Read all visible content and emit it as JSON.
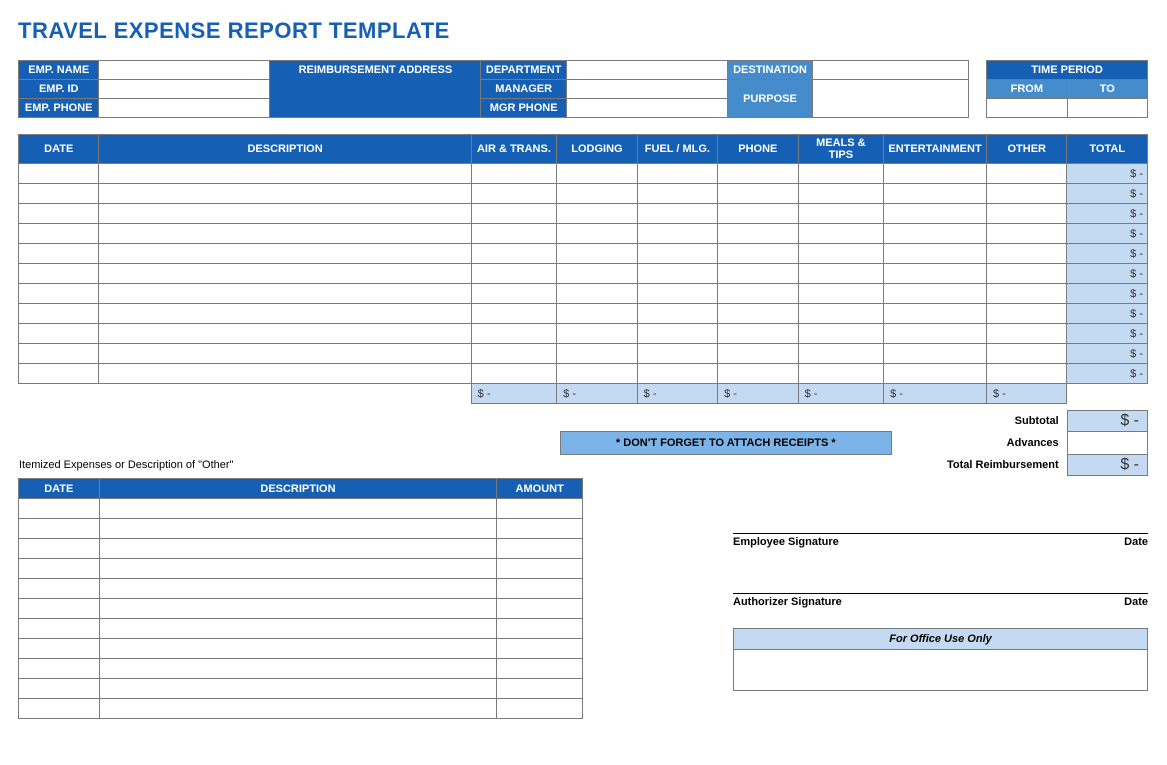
{
  "title": "TRAVEL EXPENSE REPORT TEMPLATE",
  "header": {
    "emp_name": "EMP. NAME",
    "emp_id": "EMP. ID",
    "emp_phone": "EMP. PHONE",
    "reimb_addr": "REIMBURSEMENT ADDRESS",
    "department": "DEPARTMENT",
    "manager": "MANAGER",
    "mgr_phone": "MGR PHONE",
    "destination": "DESTINATION",
    "purpose": "PURPOSE",
    "time_period": "TIME PERIOD",
    "from": "FROM",
    "to": "TO"
  },
  "cols": {
    "date": "DATE",
    "description": "DESCRIPTION",
    "air": "AIR & TRANS.",
    "lodging": "LODGING",
    "fuel": "FUEL / MLG.",
    "phone": "PHONE",
    "meals": "MEALS & TIPS",
    "ent": "ENTERTAINMENT",
    "other": "OTHER",
    "total": "TOTAL",
    "amount": "AMOUNT"
  },
  "row_total": "$            -",
  "col_total": "$            -",
  "summary": {
    "subtotal_label": "Subtotal",
    "subtotal_value": "$            -",
    "advances_label": "Advances",
    "advances_value": "",
    "total_reimb_label": "Total Reimbursement",
    "total_reimb_value": "$            -"
  },
  "receipts_note": "* DON'T FORGET TO ATTACH RECEIPTS *",
  "itemized_title": "Itemized Expenses or Description of \"Other\"",
  "sig": {
    "employee": "Employee Signature",
    "authorizer": "Authorizer Signature",
    "date": "Date"
  },
  "office_use": "For Office Use Only"
}
